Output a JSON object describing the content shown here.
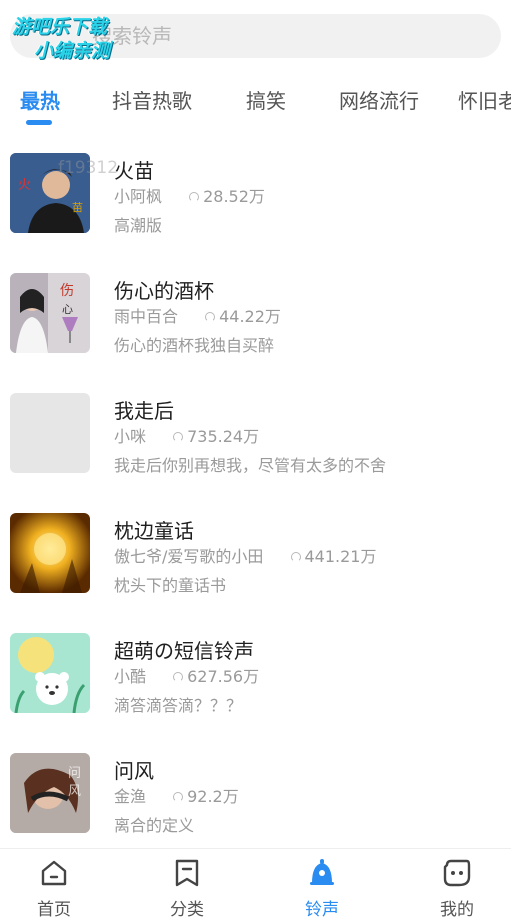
{
  "search": {
    "placeholder": "搜索铃声"
  },
  "watermark": {
    "line1": "游吧乐下载",
    "line2": "小编亲测"
  },
  "tabs": [
    {
      "label": "最热",
      "active": true
    },
    {
      "label": "抖音热歌",
      "active": false
    },
    {
      "label": "搞笑",
      "active": false
    },
    {
      "label": "网络流行",
      "active": false
    },
    {
      "label": "怀旧老",
      "active": false
    }
  ],
  "overlay_id": "f19312",
  "songs": [
    {
      "title": "火苗",
      "artist": "小阿枫",
      "plays": "28.52万",
      "desc": "高潮版",
      "cover": "portrait-red"
    },
    {
      "title": "伤心的酒杯",
      "artist": "雨中百合",
      "plays": "44.22万",
      "desc": "伤心的酒杯我独自买醉",
      "cover": "woman-wine"
    },
    {
      "title": "我走后",
      "artist": "小咪",
      "plays": "735.24万",
      "desc": "我走后你别再想我，尽管有太多的不舍",
      "cover": "blank"
    },
    {
      "title": "枕边童话",
      "artist": "傲七爷/爱写歌的小田",
      "plays": "441.21万",
      "desc": "枕头下的童话书",
      "cover": "golden-light"
    },
    {
      "title": "超萌の短信铃声",
      "artist": "小酷",
      "plays": "627.56万",
      "desc": "滴答滴答滴？？？",
      "cover": "bear-mint"
    },
    {
      "title": "问风",
      "artist": "金渔",
      "plays": "92.2万",
      "desc": "离合的定义",
      "cover": "girl-wind"
    }
  ],
  "bottom_nav": [
    {
      "label": "首页",
      "icon": "home-icon",
      "active": false
    },
    {
      "label": "分类",
      "icon": "category-icon",
      "active": false
    },
    {
      "label": "铃声",
      "icon": "bell-icon",
      "active": true
    },
    {
      "label": "我的",
      "icon": "profile-icon",
      "active": false
    }
  ],
  "colors": {
    "accent": "#2a8cf0",
    "text": "#1f1f1f",
    "muted": "#9a9a9a",
    "search_bg": "#f1f1f1"
  }
}
